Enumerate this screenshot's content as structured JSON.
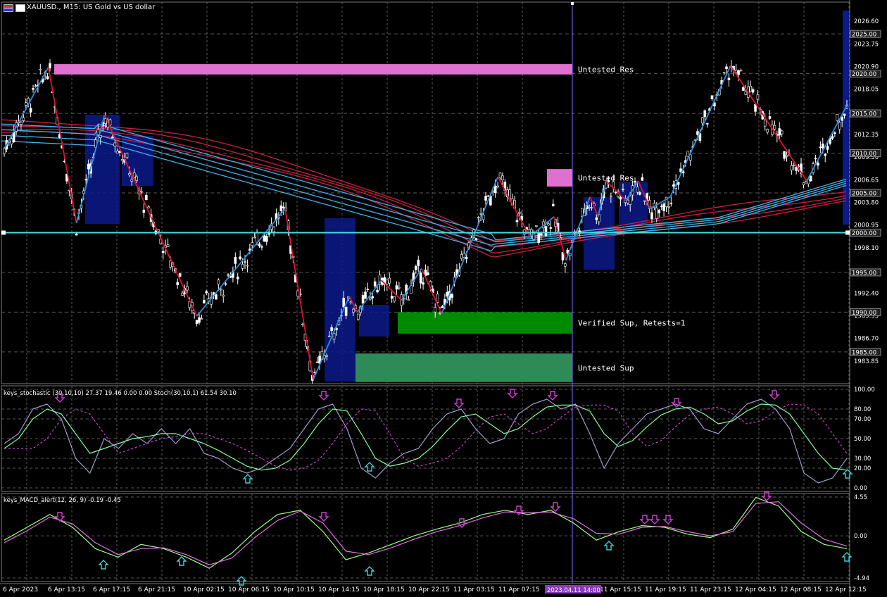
{
  "chart_header": {
    "title": "XAUUSD., M15:  US Gold vs US dollar",
    "left_icon": "chart-type-icon",
    "right_icon": "window-icon"
  },
  "colors": {
    "background": "#000000",
    "grid": "#5a5a5a",
    "axis_text": "#ffffff",
    "bull_candle": "#ffffff",
    "bear_candle": "#ffffff",
    "zigzag_up": "#2f8ddc",
    "zigzag_down": "#e01030",
    "ema_red": "#c82040",
    "ema_blue": "#40b0e8",
    "hline_cyan": "#40e0e0",
    "vline": "#7a6cff",
    "zone_res": "#e070d0",
    "zone_sup_verified": "#008a00",
    "zone_sup_untested": "#2e8b57",
    "box_blue": "#0c1a8a",
    "arrow_down": "#d040d0",
    "arrow_up": "#40d0d0",
    "stoch_main": "#9aa0c8",
    "stoch_signal": "#80ffa0",
    "stoch_dash": "#d040d0",
    "macd_main": "#a0ff80",
    "macd_signal": "#e070e0"
  },
  "chart_data": [
    {
      "type": "candlestick",
      "title": "XAUUSD., M15:  US Gold vs US dollar",
      "ylim": [
        1981.0,
        2029.0
      ],
      "y_ticks": [
        "2026.60",
        "2023.75",
        "2020.90",
        "2018.05",
        "2015.20",
        "2012.35",
        "2009.50",
        "2006.65",
        "2003.80",
        "2000.95",
        "1998.10",
        "1992.40",
        "1989.55",
        "1986.70",
        "1983.85"
      ],
      "y_price_labels": [
        "2025.00",
        "2020.00",
        "2015.00",
        "2010.00",
        "2005.00",
        "2000.00",
        "1995.00",
        "1990.00",
        "1985.00"
      ],
      "x_labels": [
        "6 Apr 2023",
        "6 Apr 13:15",
        "6 Apr 17:15",
        "6 Apr 21:15",
        "10 Apr 02:15",
        "10 Apr 06:15",
        "10 Apr 10:15",
        "10 Apr 14:15",
        "10 Apr 18:15",
        "10 Apr 22:15",
        "11 Apr 03:15",
        "11 Apr 07:15",
        "11 Apr 15:15",
        "11 Apr 19:15",
        "11 Apr 23:15",
        "12 Apr 04:15",
        "12 Apr 08:15",
        "12 Apr 12:15"
      ],
      "x_cursor_label": "2023.04.11 14:00",
      "zones": [
        {
          "label": "Untested Res",
          "kind": "resistance",
          "top": 2021.2,
          "bottom": 2019.9
        },
        {
          "label": "Untested Res",
          "kind": "resistance",
          "top": 2008.0,
          "bottom": 2005.8
        },
        {
          "label": "Verified Sup, Retests=1",
          "kind": "support_verified",
          "top": 1990.0,
          "bottom": 1987.3
        },
        {
          "label": "Untested Sup",
          "kind": "support_untested",
          "top": 1984.8,
          "bottom": 1981.2
        }
      ],
      "hline_price": 2000.0,
      "zigzag": [
        {
          "t": 0,
          "p": 2010.5
        },
        {
          "t": 11,
          "p": 2020.8
        },
        {
          "t": 18,
          "p": 2001.2
        },
        {
          "t": 25,
          "p": 2014.8
        },
        {
          "t": 37,
          "p": 2001.5
        },
        {
          "t": 48,
          "p": 1989.5
        },
        {
          "t": 70,
          "p": 2003.0
        },
        {
          "t": 77,
          "p": 1981.5
        },
        {
          "t": 86,
          "p": 1992.0
        },
        {
          "t": 88,
          "p": 1990.0
        },
        {
          "t": 94,
          "p": 1994.0
        },
        {
          "t": 99,
          "p": 1991.5
        },
        {
          "t": 104,
          "p": 1995.5
        },
        {
          "t": 109,
          "p": 1989.8
        },
        {
          "t": 123,
          "p": 2007.0
        },
        {
          "t": 131,
          "p": 1999.5
        },
        {
          "t": 137,
          "p": 2002.0
        },
        {
          "t": 140,
          "p": 1996.5
        },
        {
          "t": 146,
          "p": 2004.5
        },
        {
          "t": 148,
          "p": 2002.0
        },
        {
          "t": 150,
          "p": 2006.5
        },
        {
          "t": 155,
          "p": 2004.0
        },
        {
          "t": 158,
          "p": 2006.5
        },
        {
          "t": 161,
          "p": 2003.0
        },
        {
          "t": 166,
          "p": 2004.5
        },
        {
          "t": 181,
          "p": 2021.0
        },
        {
          "t": 200,
          "p": 2006.5
        },
        {
          "t": 210,
          "p": 2016.0
        }
      ]
    },
    {
      "type": "line",
      "title": "keys_stochastic (30,10,10) 27.37 19.46 0.00 0.00 Stoch(30,10,1) 61.54 30.10",
      "ylim": [
        0,
        100
      ],
      "y_ticks": [
        "100.00",
        "80.00",
        "70.00",
        "50.00",
        "30.00",
        "20.00",
        "0.00"
      ],
      "series": [
        {
          "values": [
            45,
            55,
            80,
            85,
            70,
            30,
            15,
            50,
            40,
            55,
            45,
            60,
            45,
            60,
            35,
            30,
            20,
            15,
            20,
            30,
            40,
            60,
            80,
            85,
            60,
            20,
            10,
            25,
            35,
            40,
            60,
            75,
            80,
            60,
            45,
            50,
            75,
            85,
            90,
            80,
            85,
            55,
            20,
            45,
            60,
            75,
            80,
            85,
            80,
            60,
            55,
            70,
            85,
            90,
            80,
            60,
            15,
            5,
            10,
            30
          ]
        },
        {
          "values": [
            40,
            50,
            70,
            80,
            75,
            55,
            35,
            40,
            45,
            50,
            52,
            55,
            55,
            50,
            45,
            38,
            30,
            22,
            18,
            20,
            28,
            45,
            65,
            80,
            78,
            55,
            30,
            22,
            25,
            30,
            42,
            58,
            72,
            75,
            65,
            55,
            60,
            72,
            82,
            84,
            84,
            78,
            55,
            42,
            48,
            62,
            74,
            80,
            82,
            75,
            65,
            68,
            78,
            85,
            84,
            75,
            55,
            35,
            20,
            18
          ]
        }
      ],
      "arrows_down_count": 8,
      "arrows_up_count": 4
    },
    {
      "type": "line",
      "title": "keys_MACD_alert(12, 26, 9) -0.19 -0.45",
      "ylim": [
        -4.94,
        4.55
      ],
      "y_ticks": [
        "4.55",
        "0.00",
        "-4.94"
      ],
      "series": [
        {
          "values": [
            -0.5,
            1.0,
            2.5,
            1.0,
            -1.5,
            -2.5,
            -1.0,
            -1.5,
            -2.5,
            -3.8,
            -2.0,
            0.5,
            2.5,
            3.0,
            0.5,
            -2.8,
            -2.0,
            -1.0,
            0.0,
            0.8,
            1.5,
            2.5,
            3.0,
            2.5,
            3.0,
            1.5,
            -0.5,
            0.5,
            1.2,
            1.0,
            0.2,
            -0.2,
            0.8,
            4.5,
            3.5,
            0.5,
            -1.0,
            -1.5
          ]
        },
        {
          "values": [
            -0.8,
            0.6,
            2.2,
            1.4,
            -0.8,
            -2.2,
            -1.5,
            -1.4,
            -2.2,
            -3.4,
            -2.6,
            -0.2,
            1.8,
            2.9,
            1.5,
            -1.8,
            -2.2,
            -1.4,
            -0.4,
            0.5,
            1.2,
            2.1,
            2.8,
            2.7,
            2.8,
            2.0,
            0.3,
            0.2,
            1.0,
            1.1,
            0.5,
            0.0,
            0.5,
            3.8,
            4.0,
            1.5,
            -0.4,
            -1.2
          ]
        }
      ],
      "arrows_down_count": 10,
      "arrows_up_count": 6
    }
  ]
}
